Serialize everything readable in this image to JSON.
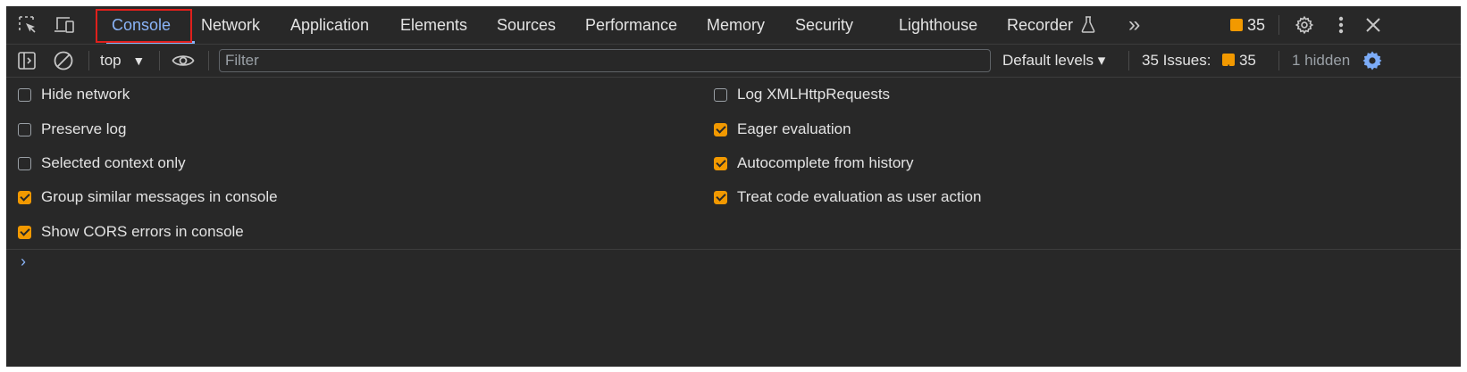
{
  "tabs": [
    {
      "label": "Console",
      "active": true
    },
    {
      "label": "Network"
    },
    {
      "label": "Application"
    },
    {
      "label": "Elements"
    },
    {
      "label": "Sources"
    },
    {
      "label": "Performance"
    },
    {
      "label": "Memory"
    },
    {
      "label": "Security"
    },
    {
      "label": "Lighthouse"
    },
    {
      "label": "Recorder"
    }
  ],
  "tabbar": {
    "more_tabs_label": "»",
    "issues_count": "35",
    "icons": [
      "inspect-element-icon",
      "device-toolbar-icon",
      "flask-icon",
      "gear-icon",
      "kebab-menu-icon",
      "close-icon"
    ]
  },
  "toolbar": {
    "context": "top",
    "filter_placeholder": "Filter",
    "default_levels": "Default levels ▾",
    "issues_label": "35 Issues:",
    "issues_count": "35",
    "hidden_label": "1 hidden"
  },
  "settings": {
    "left": [
      {
        "label": "Hide network",
        "checked": false
      },
      {
        "label": "Preserve log",
        "checked": false
      },
      {
        "label": "Selected context only",
        "checked": false
      },
      {
        "label": "Group similar messages in console",
        "checked": true
      },
      {
        "label": "Show CORS errors in console",
        "checked": true
      }
    ],
    "right": [
      {
        "label": "Log XMLHttpRequests",
        "checked": false
      },
      {
        "label": "Eager evaluation",
        "checked": true
      },
      {
        "label": "Autocomplete from history",
        "checked": true
      },
      {
        "label": "Treat code evaluation as user action",
        "checked": true
      }
    ]
  },
  "console": {
    "prompt": "›"
  },
  "colors": {
    "accent": "#8ab4f8",
    "warning": "#f29900",
    "highlight": "#e0201c",
    "background": "#282828"
  }
}
